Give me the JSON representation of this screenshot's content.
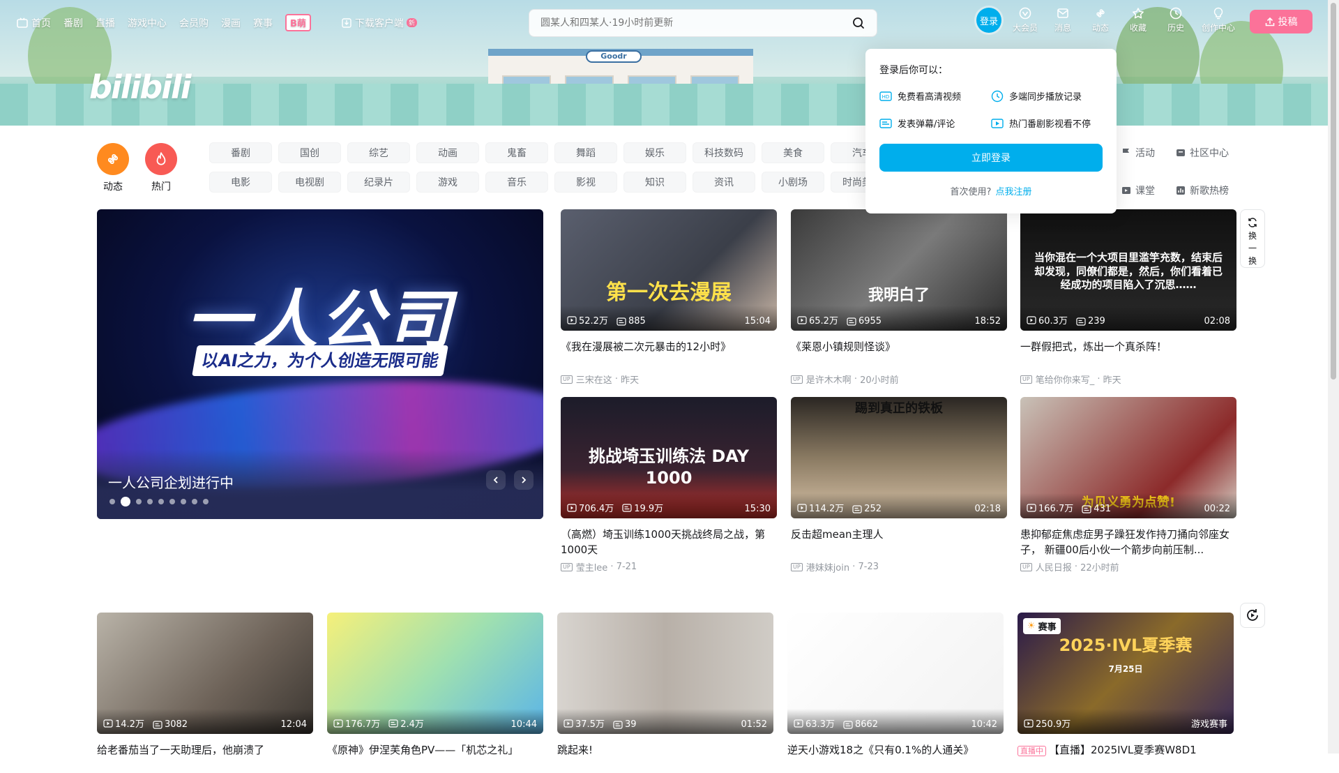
{
  "nav": {
    "left": [
      {
        "label": "首页",
        "icon": "tv-icon"
      },
      {
        "label": "番剧"
      },
      {
        "label": "直播"
      },
      {
        "label": "游戏中心"
      },
      {
        "label": "会员购"
      },
      {
        "label": "漫画"
      },
      {
        "label": "赛事"
      }
    ],
    "special_badge": "B萌",
    "download_label": "下载客户端",
    "download_badge": "新",
    "search_placeholder": "圆某人和四某人·19小时前更新",
    "login_label": "登录",
    "right": [
      {
        "label": "大会员",
        "icon": "vip-icon"
      },
      {
        "label": "消息",
        "icon": "message-icon"
      },
      {
        "label": "动态",
        "icon": "wind-icon"
      },
      {
        "label": "收藏",
        "icon": "star-icon"
      },
      {
        "label": "历史",
        "icon": "clock-icon"
      },
      {
        "label": "创作中心",
        "icon": "lightbulb-icon"
      }
    ],
    "upload_label": "投稿",
    "logo_text": "bilibili"
  },
  "channels": {
    "main": [
      {
        "label": "动态",
        "color": "#ff8a1f"
      },
      {
        "label": "热门",
        "color": "#f85a54"
      }
    ],
    "tags": [
      "番剧",
      "国创",
      "综艺",
      "动画",
      "鬼畜",
      "舞蹈",
      "娱乐",
      "科技数码",
      "美食",
      "汽车",
      "",
      "电影",
      "电视剧",
      "纪录片",
      "游戏",
      "音乐",
      "影视",
      "知识",
      "资讯",
      "小剧场",
      "时尚美妆",
      ""
    ],
    "right": [
      "活动",
      "社区中心",
      "课堂",
      "新歌热榜"
    ]
  },
  "login_popover": {
    "title": "登录后你可以：",
    "features": [
      "免费看高清视频",
      "多端同步播放记录",
      "发表弹幕/评论",
      "热门番剧影视看不停"
    ],
    "button": "立即登录",
    "first_use": "首次使用?",
    "register_link": "点我注册"
  },
  "carousel": {
    "big_title": "一人公司",
    "subtitle": "以AI之力，为个人创造无限可能",
    "caption": "一人公司企划进行中",
    "dot_count": 9,
    "active_dot": 1
  },
  "refresh_label": [
    "换",
    "一",
    "换"
  ],
  "videos": [
    {
      "title": "《我在漫展被二次元暴击的12小时》",
      "views": "52.2万",
      "danmaku": "885",
      "duration": "15:04",
      "author": "三宋在这",
      "time": "昨天",
      "caption": "第一次去漫展"
    },
    {
      "title": "《莱恩小镇规则怪谈》",
      "views": "65.2万",
      "danmaku": "6955",
      "duration": "18:52",
      "author": "是许木木啊",
      "time": "20小时前",
      "caption": "我明白了"
    },
    {
      "title": "一群假把式，炼出一个真杀阵！",
      "views": "60.3万",
      "danmaku": "239",
      "duration": "02:08",
      "author": "笔给你你来写_",
      "time": "昨天",
      "caption": "当你混在一个大项目里滥竽充数，结束后却发现，同僚们都是，然后，你们看着已经成功的项目陷入了沉思……"
    },
    {
      "title": "（高燃）埼玉训练1000天挑战终局之战，第1000天",
      "views": "706.4万",
      "danmaku": "19.9万",
      "duration": "15:30",
      "author": "莹主lee",
      "time": "7-21",
      "caption": "挑战埼玉训练法 DAY 1000"
    },
    {
      "title": "反击超mean主理人",
      "views": "114.2万",
      "danmaku": "252",
      "duration": "02:18",
      "author": "港妹妹join",
      "time": "7-23",
      "caption": "踢到真正的铁板"
    },
    {
      "title": "患抑郁症焦虑症男子躁狂发作持刀捅向邻座女子， 新疆00后小伙一个箭步向前压制...",
      "views": "166.7万",
      "danmaku": "431",
      "duration": "00:22",
      "author": "人民日报",
      "time": "22小时前",
      "caption": "为见义勇为点赞!"
    },
    {
      "title": "给老番茄当了一天助理后，他崩溃了",
      "views": "14.2万",
      "danmaku": "3082",
      "duration": "12:04"
    },
    {
      "title": "《原神》伊涅芙角色PV——「机芯之礼」",
      "views": "176.7万",
      "danmaku": "2.4万",
      "duration": "10:44"
    },
    {
      "title": "跳起来!",
      "views": "37.5万",
      "danmaku": "39",
      "duration": "01:52"
    },
    {
      "title": "逆天小游戏18之《只有0.1%的人通关》",
      "views": "63.3万",
      "danmaku": "8662",
      "duration": "10:42"
    },
    {
      "title": "【直播】2025IVL夏季赛W8D1",
      "views": "250.9万",
      "duration": "游戏赛事",
      "live_tag": "直播中",
      "badge": "赛事",
      "caption": "2025·IVL夏季赛",
      "date": "7月25日"
    }
  ]
}
